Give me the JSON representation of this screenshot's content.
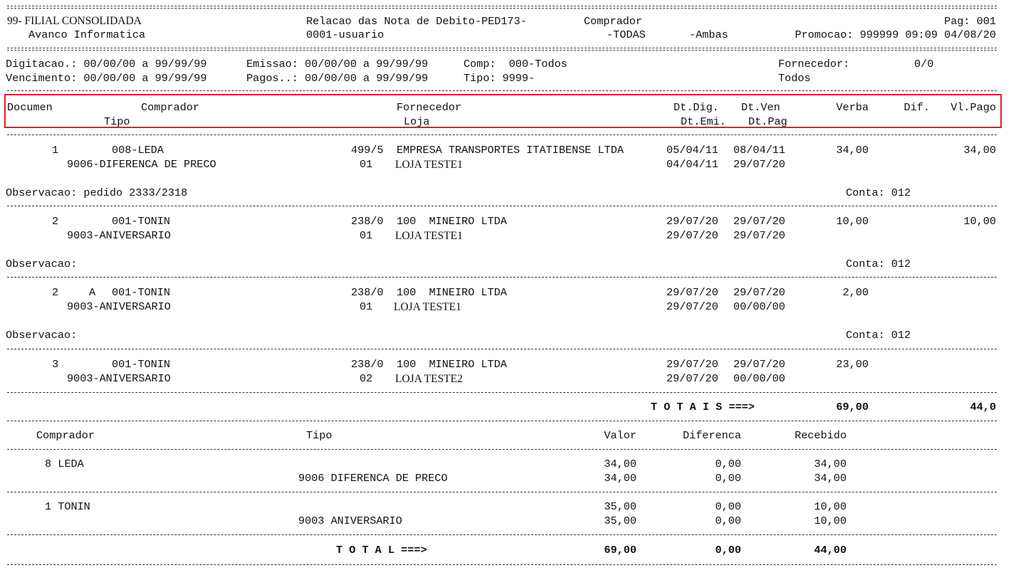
{
  "header": {
    "company": "99- FILIAL CONSOLIDADA",
    "report_title": "Relacao das Nota de Debito-PED173-",
    "group_by": "Comprador",
    "page": "Pag: 001",
    "software": "Avanco Informatica",
    "user": "0001-usuario",
    "filter_todas": "-TODAS",
    "filter_ambas": "-Ambas",
    "promo": "Promocao: 999999 09:09 04/08/20"
  },
  "filters": {
    "digitacao": "Digitacao.: 00/00/00 a 99/99/99",
    "emissao": "Emissao: 00/00/00 a 99/99/99",
    "comp": "Comp:  000-Todos",
    "fornecedor_label": "Fornecedor:",
    "fornecedor_value": "0/0",
    "vencimento": "Vencimento: 00/00/00 a 99/99/99",
    "pagos": "Pagos..: 00/00/00 a 99/99/99",
    "tipo": "Tipo: 9999-",
    "todos": "Todos"
  },
  "columns": {
    "documen": "Documen",
    "comprador": "Comprador",
    "fornecedor": "Fornecedor",
    "dt_dig": "Dt.Dig.",
    "dt_ven": "Dt.Ven",
    "verba": "Verba",
    "dif": "Dif.",
    "vl_pago": "Vl.Pago",
    "tipo": "Tipo",
    "loja": "Loja",
    "dt_emi": "Dt.Emi.",
    "dt_pag": "Dt.Pag"
  },
  "records": [
    {
      "doc": "1",
      "flag": "",
      "comprador": "008-LEDA",
      "fornecedor_code": "499/5",
      "fornecedor": "EMPRESA TRANSPORTES ITATIBENSE LTDA",
      "dt_dig": "05/04/11",
      "dt_ven": "08/04/11",
      "verba": "34,00",
      "vl_pago": "34,00",
      "tipo": "9006-DIFERENCA DE PRECO",
      "loja_code": "01",
      "loja": "LOJA TESTE1",
      "dt_emi": "04/04/11",
      "dt_pag": "29/07/20",
      "obs": "Observacao: pedido 2333/2318",
      "conta": "Conta: 012"
    },
    {
      "doc": "2",
      "flag": "",
      "comprador": "001-TONIN",
      "fornecedor_code": "238/0",
      "fornecedor": "100  MINEIRO LTDA",
      "dt_dig": "29/07/20",
      "dt_ven": "29/07/20",
      "verba": "10,00",
      "vl_pago": "10,00",
      "tipo": "9003-ANIVERSARIO",
      "loja_code": "01",
      "loja": "LOJA TESTE1",
      "dt_emi": "29/07/20",
      "dt_pag": "29/07/20",
      "obs": "Observacao:",
      "conta": "Conta: 012"
    },
    {
      "doc": "2",
      "flag": "A",
      "comprador": "001-TONIN",
      "fornecedor_code": "238/0",
      "fornecedor": "100  MINEIRO LTDA",
      "dt_dig": "29/07/20",
      "dt_ven": "29/07/20",
      "verba": "2,00",
      "vl_pago": "",
      "tipo": "9003-ANIVERSARIO",
      "loja_code": "01",
      "loja": "LOJA TESTE1",
      "dt_emi": "29/07/20",
      "dt_pag": "00/00/00",
      "obs": "Observacao:",
      "conta": "Conta: 012"
    },
    {
      "doc": "3",
      "flag": "",
      "comprador": "001-TONIN",
      "fornecedor_code": "238/0",
      "fornecedor": "100  MINEIRO LTDA",
      "dt_dig": "29/07/20",
      "dt_ven": "29/07/20",
      "verba": "23,00",
      "vl_pago": "",
      "tipo": "9003-ANIVERSARIO",
      "loja_code": "02",
      "loja": "LOJA TESTE2",
      "dt_emi": "29/07/20",
      "dt_pag": "00/00/00",
      "obs": "",
      "conta": ""
    }
  ],
  "totais": {
    "label": "T O T A I S ===>",
    "verba": "69,00",
    "vl_pago": "44,0"
  },
  "summary": {
    "headers": {
      "comprador": "Comprador",
      "tipo": "Tipo",
      "valor": "Valor",
      "diferenca": "Diferenca",
      "recebido": "Recebido"
    },
    "groups": [
      {
        "name": "8 LEDA",
        "valor": "34,00",
        "diferenca": "0,00",
        "recebido": "34,00",
        "tipo": "9006 DIFERENCA DE PRECO",
        "tipo_valor": "34,00",
        "tipo_diferenca": "0,00",
        "tipo_recebido": "34,00"
      },
      {
        "name": "1 TONIN",
        "valor": "35,00",
        "diferenca": "0,00",
        "recebido": "10,00",
        "tipo": "9003 ANIVERSARIO",
        "tipo_valor": "35,00",
        "tipo_diferenca": "0,00",
        "tipo_recebido": "10,00"
      }
    ],
    "total": {
      "label": "T O T A L ===>",
      "valor": "69,00",
      "diferenca": "0,00",
      "recebido": "44,00"
    }
  }
}
